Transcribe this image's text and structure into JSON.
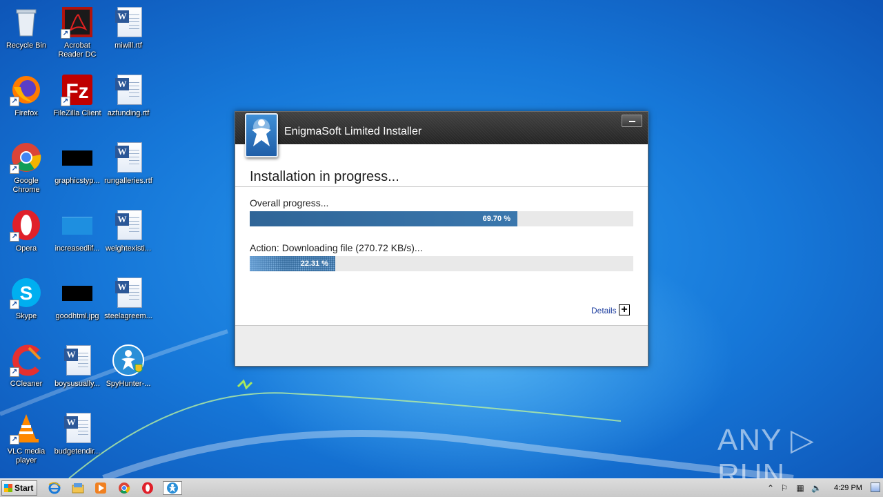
{
  "desktop": {
    "icons": [
      {
        "label": "Recycle Bin",
        "icon": "recycle-bin-icon"
      },
      {
        "label": "Acrobat Reader DC",
        "icon": "acrobat-icon"
      },
      {
        "label": "miwill.rtf",
        "icon": "rtf-document-icon"
      },
      {
        "label": "Firefox",
        "icon": "firefox-icon"
      },
      {
        "label": "FileZilla Client",
        "icon": "filezilla-icon"
      },
      {
        "label": "azfunding.rtf",
        "icon": "rtf-document-icon"
      },
      {
        "label": "Google Chrome",
        "icon": "chrome-icon"
      },
      {
        "label": "graphicstyp...",
        "icon": "image-thumbnail-icon"
      },
      {
        "label": "rungalleries.rtf",
        "icon": "rtf-document-icon"
      },
      {
        "label": "Opera",
        "icon": "opera-icon"
      },
      {
        "label": "increasedlif...",
        "icon": "image-thumbnail-icon"
      },
      {
        "label": "weightexisti...",
        "icon": "rtf-document-icon"
      },
      {
        "label": "Skype",
        "icon": "skype-icon"
      },
      {
        "label": "goodhtml.jpg",
        "icon": "image-thumbnail-icon"
      },
      {
        "label": "steelagreem...",
        "icon": "rtf-document-icon"
      },
      {
        "label": "CCleaner",
        "icon": "ccleaner-icon"
      },
      {
        "label": "boysusually...",
        "icon": "rtf-document-icon"
      },
      {
        "label": "SpyHunter-...",
        "icon": "spyhunter-icon"
      },
      {
        "label": "VLC media player",
        "icon": "vlc-icon"
      },
      {
        "label": "budgetendir...",
        "icon": "rtf-document-icon"
      }
    ]
  },
  "installer": {
    "title": "EnigmaSoft Limited Installer",
    "heading": "Installation in progress...",
    "overall_label": "Overall progress...",
    "overall_percent_text": "69.70 %",
    "overall_fraction": 0.697,
    "action_label": "Action: Downloading file (270.72 KB/s)...",
    "action_percent_text": "22.31 %",
    "action_fraction": 0.2231,
    "details_label": "Details",
    "details_toggle": "+"
  },
  "watermark": "ANY ▷ RUN",
  "taskbar": {
    "start_label": "Start",
    "clock": "4:29 PM",
    "pinned": [
      "internet-explorer-icon",
      "explorer-icon",
      "media-player-icon",
      "chrome-icon",
      "opera-icon",
      "spyhunter-installer-icon"
    ]
  },
  "colors": {
    "desktop_blue": "#1677d8",
    "progress_fill": "#2f6597",
    "progress_track": "#e9e9e9",
    "titlebar": "#2e2e2e"
  }
}
